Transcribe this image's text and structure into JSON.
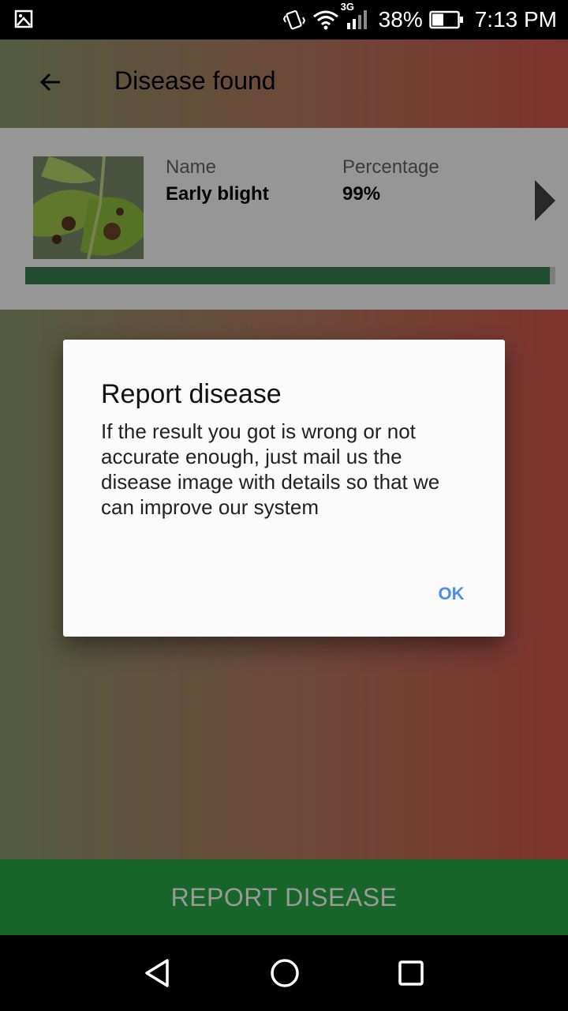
{
  "status_bar": {
    "network": "3G",
    "battery": "38%",
    "time": "7:13 PM",
    "icons": [
      "gallery-icon",
      "vibrate-icon",
      "wifi-icon",
      "signal-icon",
      "battery-icon"
    ]
  },
  "app_bar": {
    "title": "Disease found",
    "back_icon": "arrow-left-icon"
  },
  "result": {
    "name_label": "Name",
    "name_value": "Early blight",
    "percentage_label": "Percentage",
    "percentage_value": "99%",
    "progress": 0.99,
    "next_icon": "triangle-right-icon"
  },
  "report_button": {
    "label": "REPORT DISEASE"
  },
  "dialog": {
    "title": "Report disease",
    "body": "If the result you got is wrong or not accurate enough, just mail us the disease image with details so that we can improve our system",
    "ok_label": "OK"
  },
  "nav_bar": {
    "icons": [
      "back-triangle-icon",
      "home-circle-icon",
      "recents-square-icon"
    ]
  },
  "colors": {
    "report_button": "#27a845",
    "accent": "#4a8fe8",
    "progress_fill": "#3a7f4f"
  }
}
